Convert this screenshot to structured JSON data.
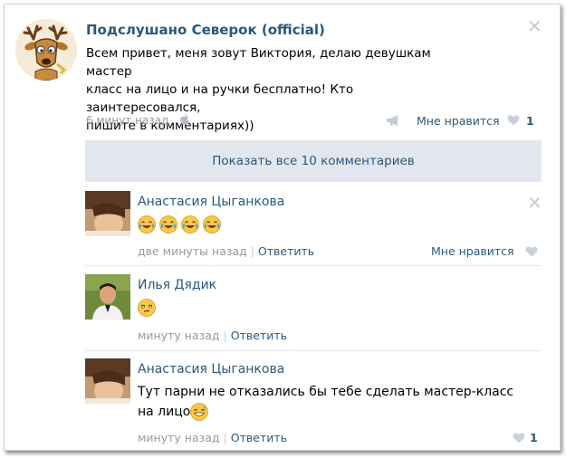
{
  "post": {
    "author": "Подслушано Северок (official)",
    "text_lines": [
      "Всем привет, меня зовут Виктория, делаю девушкам мастер",
      "класс на лицо и на ручки бесплатно! Кто заинтересовался,",
      "пишите в комментариях))"
    ],
    "time": "6 минут назад",
    "like_label": "Мне нравится",
    "like_count": "1",
    "show_all_comments": "Показать все 10 комментариев"
  },
  "comments": [
    {
      "author": "Анастасия Цыганкова",
      "text": "",
      "emoji": [
        "face-tears-of-joy",
        "face-tears-of-joy",
        "face-tears-of-joy",
        "face-tears-of-joy"
      ],
      "time": "две минуты назад",
      "reply_label": "Ответить",
      "like_label": "Мне нравится"
    },
    {
      "author": "Илья Дядик",
      "text": "",
      "emoji": [
        "face-unamused"
      ],
      "time": "минуту назад",
      "reply_label": "Ответить"
    },
    {
      "author": "Анастасия Цыганкова",
      "text_line1": "Тут парни не отказались бы тебе сделать мастер-класс",
      "text_line2": "на лицо",
      "emoji": [
        "face-grinning-sweat"
      ],
      "time": "минуту назад",
      "reply_label": "Ответить",
      "like_count": "1"
    }
  ],
  "colors": {
    "link": "#2b587a",
    "muted": "#999999",
    "show_all_bg": "#e2e7ed"
  },
  "icons": [
    "close-icon",
    "apple-icon",
    "megaphone-icon",
    "heart-icon"
  ]
}
